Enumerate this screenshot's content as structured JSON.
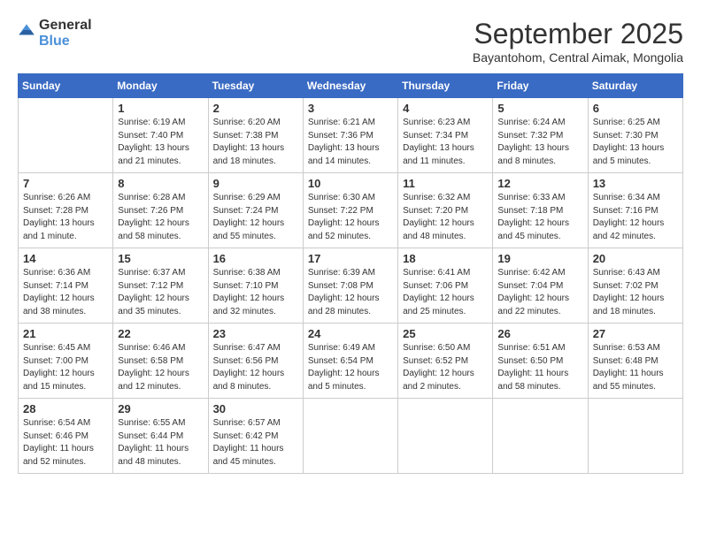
{
  "logo": {
    "general": "General",
    "blue": "Blue"
  },
  "title": "September 2025",
  "location": "Bayantohom, Central Aimak, Mongolia",
  "days_of_week": [
    "Sunday",
    "Monday",
    "Tuesday",
    "Wednesday",
    "Thursday",
    "Friday",
    "Saturday"
  ],
  "weeks": [
    [
      {
        "day": "",
        "info": ""
      },
      {
        "day": "1",
        "info": "Sunrise: 6:19 AM\nSunset: 7:40 PM\nDaylight: 13 hours\nand 21 minutes."
      },
      {
        "day": "2",
        "info": "Sunrise: 6:20 AM\nSunset: 7:38 PM\nDaylight: 13 hours\nand 18 minutes."
      },
      {
        "day": "3",
        "info": "Sunrise: 6:21 AM\nSunset: 7:36 PM\nDaylight: 13 hours\nand 14 minutes."
      },
      {
        "day": "4",
        "info": "Sunrise: 6:23 AM\nSunset: 7:34 PM\nDaylight: 13 hours\nand 11 minutes."
      },
      {
        "day": "5",
        "info": "Sunrise: 6:24 AM\nSunset: 7:32 PM\nDaylight: 13 hours\nand 8 minutes."
      },
      {
        "day": "6",
        "info": "Sunrise: 6:25 AM\nSunset: 7:30 PM\nDaylight: 13 hours\nand 5 minutes."
      }
    ],
    [
      {
        "day": "7",
        "info": "Sunrise: 6:26 AM\nSunset: 7:28 PM\nDaylight: 13 hours\nand 1 minute."
      },
      {
        "day": "8",
        "info": "Sunrise: 6:28 AM\nSunset: 7:26 PM\nDaylight: 12 hours\nand 58 minutes."
      },
      {
        "day": "9",
        "info": "Sunrise: 6:29 AM\nSunset: 7:24 PM\nDaylight: 12 hours\nand 55 minutes."
      },
      {
        "day": "10",
        "info": "Sunrise: 6:30 AM\nSunset: 7:22 PM\nDaylight: 12 hours\nand 52 minutes."
      },
      {
        "day": "11",
        "info": "Sunrise: 6:32 AM\nSunset: 7:20 PM\nDaylight: 12 hours\nand 48 minutes."
      },
      {
        "day": "12",
        "info": "Sunrise: 6:33 AM\nSunset: 7:18 PM\nDaylight: 12 hours\nand 45 minutes."
      },
      {
        "day": "13",
        "info": "Sunrise: 6:34 AM\nSunset: 7:16 PM\nDaylight: 12 hours\nand 42 minutes."
      }
    ],
    [
      {
        "day": "14",
        "info": "Sunrise: 6:36 AM\nSunset: 7:14 PM\nDaylight: 12 hours\nand 38 minutes."
      },
      {
        "day": "15",
        "info": "Sunrise: 6:37 AM\nSunset: 7:12 PM\nDaylight: 12 hours\nand 35 minutes."
      },
      {
        "day": "16",
        "info": "Sunrise: 6:38 AM\nSunset: 7:10 PM\nDaylight: 12 hours\nand 32 minutes."
      },
      {
        "day": "17",
        "info": "Sunrise: 6:39 AM\nSunset: 7:08 PM\nDaylight: 12 hours\nand 28 minutes."
      },
      {
        "day": "18",
        "info": "Sunrise: 6:41 AM\nSunset: 7:06 PM\nDaylight: 12 hours\nand 25 minutes."
      },
      {
        "day": "19",
        "info": "Sunrise: 6:42 AM\nSunset: 7:04 PM\nDaylight: 12 hours\nand 22 minutes."
      },
      {
        "day": "20",
        "info": "Sunrise: 6:43 AM\nSunset: 7:02 PM\nDaylight: 12 hours\nand 18 minutes."
      }
    ],
    [
      {
        "day": "21",
        "info": "Sunrise: 6:45 AM\nSunset: 7:00 PM\nDaylight: 12 hours\nand 15 minutes."
      },
      {
        "day": "22",
        "info": "Sunrise: 6:46 AM\nSunset: 6:58 PM\nDaylight: 12 hours\nand 12 minutes."
      },
      {
        "day": "23",
        "info": "Sunrise: 6:47 AM\nSunset: 6:56 PM\nDaylight: 12 hours\nand 8 minutes."
      },
      {
        "day": "24",
        "info": "Sunrise: 6:49 AM\nSunset: 6:54 PM\nDaylight: 12 hours\nand 5 minutes."
      },
      {
        "day": "25",
        "info": "Sunrise: 6:50 AM\nSunset: 6:52 PM\nDaylight: 12 hours\nand 2 minutes."
      },
      {
        "day": "26",
        "info": "Sunrise: 6:51 AM\nSunset: 6:50 PM\nDaylight: 11 hours\nand 58 minutes."
      },
      {
        "day": "27",
        "info": "Sunrise: 6:53 AM\nSunset: 6:48 PM\nDaylight: 11 hours\nand 55 minutes."
      }
    ],
    [
      {
        "day": "28",
        "info": "Sunrise: 6:54 AM\nSunset: 6:46 PM\nDaylight: 11 hours\nand 52 minutes."
      },
      {
        "day": "29",
        "info": "Sunrise: 6:55 AM\nSunset: 6:44 PM\nDaylight: 11 hours\nand 48 minutes."
      },
      {
        "day": "30",
        "info": "Sunrise: 6:57 AM\nSunset: 6:42 PM\nDaylight: 11 hours\nand 45 minutes."
      },
      {
        "day": "",
        "info": ""
      },
      {
        "day": "",
        "info": ""
      },
      {
        "day": "",
        "info": ""
      },
      {
        "day": "",
        "info": ""
      }
    ]
  ]
}
